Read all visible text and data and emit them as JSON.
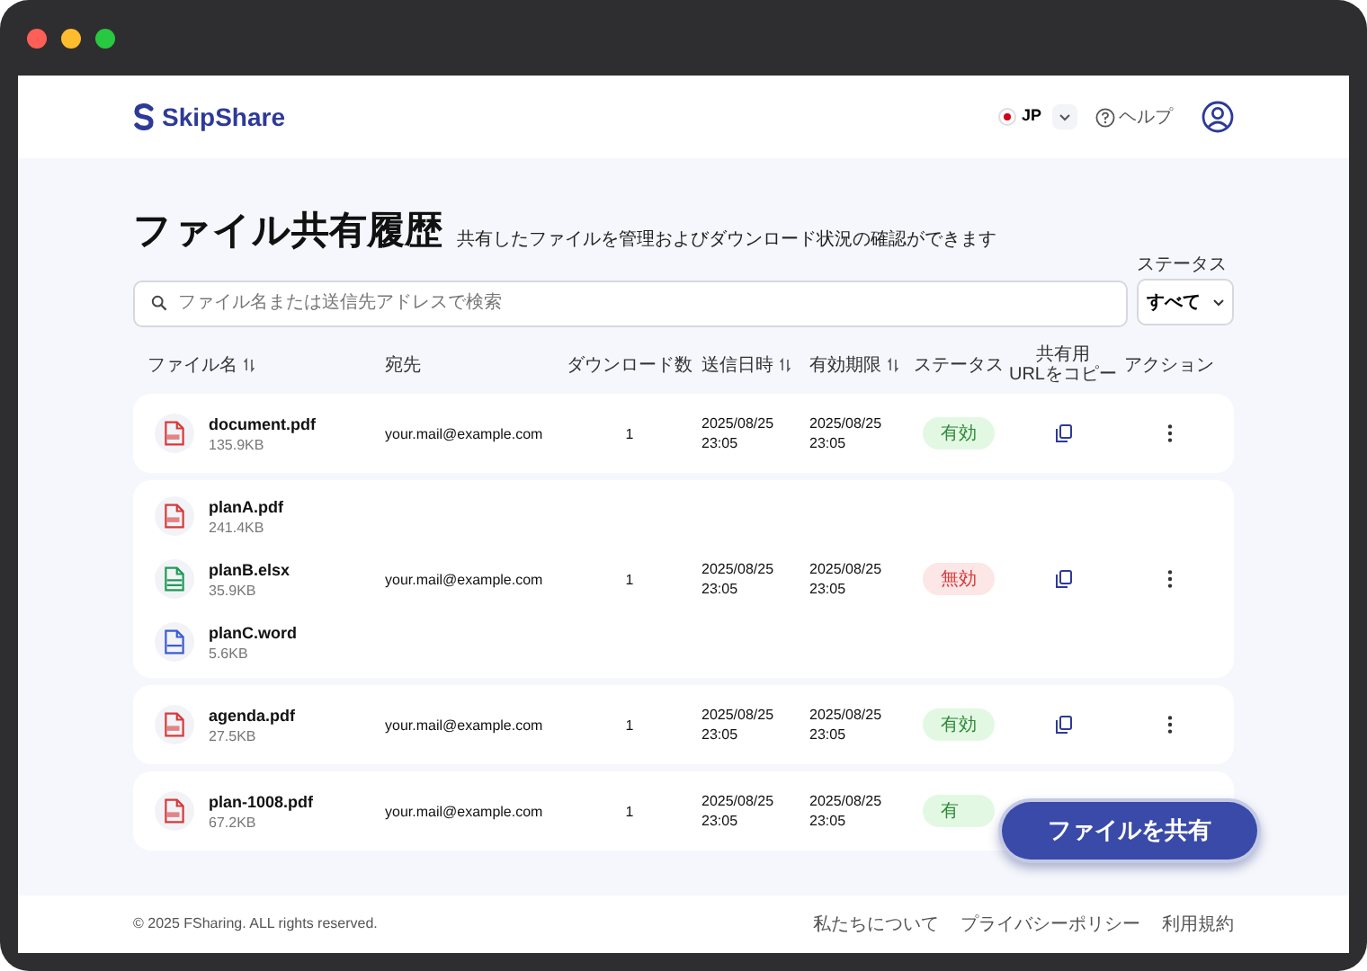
{
  "window": {
    "controls": [
      {
        "color": "#ff5f57"
      },
      {
        "color": "#febc2e"
      },
      {
        "color": "#28c840"
      }
    ]
  },
  "header": {
    "logo": "SkipShare",
    "language": "JP",
    "help": "ヘルプ"
  },
  "page": {
    "title": "ファイル共有履歴",
    "subtitle": "共有したファイルを管理およびダウンロード状況の確認ができます",
    "search": {
      "placeholder": "ファイル名または送信先アドレスで検索"
    },
    "status_filter": {
      "label": "ステータス",
      "value": "すべて"
    }
  },
  "table": {
    "columns": [
      {
        "label": "ファイル名",
        "sortable": true
      },
      {
        "label": "宛先",
        "sortable": false
      },
      {
        "label": "ダウンロード数",
        "sortable": false
      },
      {
        "label": "送信日時",
        "sortable": true
      },
      {
        "label": "有効期限",
        "sortable": true
      },
      {
        "label": "ステータス",
        "sortable": false
      },
      {
        "label": "共有用\nURLをコピー",
        "sortable": false
      },
      {
        "label": "アクション",
        "sortable": false
      }
    ],
    "rows": [
      {
        "files": [
          {
            "name": "document.pdf",
            "size": "135.9KB",
            "kind": "pdf"
          }
        ],
        "recipient": "your.mail@example.com",
        "downloads": "1",
        "sent": "2025/08/25\n23:05",
        "expires": "2025/08/25\n23:05",
        "status": {
          "label": "有効",
          "kind": "valid"
        }
      },
      {
        "files": [
          {
            "name": "planA.pdf",
            "size": "241.4KB",
            "kind": "pdf"
          },
          {
            "name": "planB.elsx",
            "size": "35.9KB",
            "kind": "excel"
          },
          {
            "name": "planC.word",
            "size": "5.6KB",
            "kind": "word"
          }
        ],
        "recipient": "your.mail@example.com",
        "downloads": "1",
        "sent": "2025/08/25\n23:05",
        "expires": "2025/08/25\n23:05",
        "status": {
          "label": "無効",
          "kind": "invalid"
        }
      },
      {
        "files": [
          {
            "name": "agenda.pdf",
            "size": "27.5KB",
            "kind": "pdf"
          }
        ],
        "recipient": "your.mail@example.com",
        "downloads": "1",
        "sent": "2025/08/25\n23:05",
        "expires": "2025/08/25\n23:05",
        "status": {
          "label": "有効",
          "kind": "valid"
        }
      },
      {
        "files": [
          {
            "name": "plan-1008.pdf",
            "size": "67.2KB",
            "kind": "pdf"
          }
        ],
        "recipient": "your.mail@example.com",
        "downloads": "1",
        "sent": "2025/08/25\n23:05",
        "expires": "2025/08/25\n23:05",
        "status": {
          "label": "有",
          "kind": "valid"
        }
      }
    ]
  },
  "share_button": "ファイルを共有",
  "footer": {
    "copyright": "© 2025 FSharing. ALL rights reserved.",
    "links": [
      "私たちについて",
      "プライバシーポリシー",
      "利用規約"
    ]
  }
}
